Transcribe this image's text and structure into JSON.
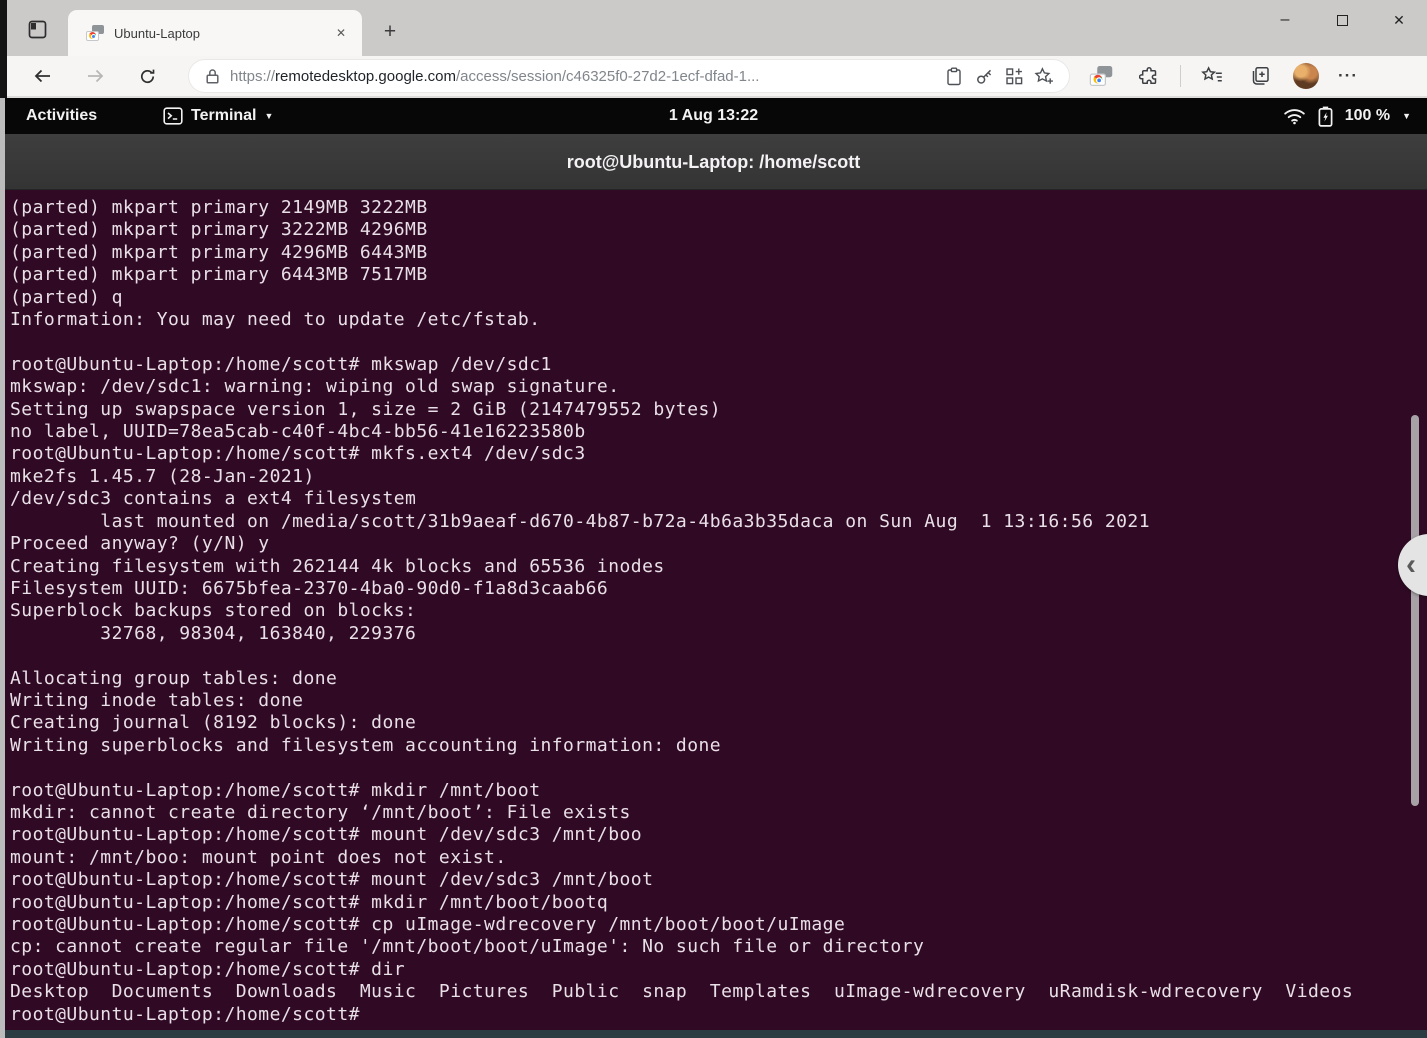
{
  "browser": {
    "tab_title": "Ubuntu-Laptop",
    "url": {
      "scheme": "https://",
      "host": "remotedesktop.google.com",
      "path": "/access/session/c46325f0-27d2-1ecf-dfad-1..."
    }
  },
  "desktop_bar": {
    "activities_label": "Activities",
    "app_name": "Terminal",
    "clock": "1 Aug 13:22",
    "battery_percent": "100 %"
  },
  "terminal": {
    "title": "root@Ubuntu-Laptop: /home/scott",
    "lines": [
      "(parted) mkpart primary 2149MB 3222MB",
      "(parted) mkpart primary 3222MB 4296MB",
      "(parted) mkpart primary 4296MB 6443MB",
      "(parted) mkpart primary 6443MB 7517MB",
      "(parted) q",
      "Information: You may need to update /etc/fstab.",
      "",
      "root@Ubuntu-Laptop:/home/scott# mkswap /dev/sdc1",
      "mkswap: /dev/sdc1: warning: wiping old swap signature.",
      "Setting up swapspace version 1, size = 2 GiB (2147479552 bytes)",
      "no label, UUID=78ea5cab-c40f-4bc4-bb56-41e16223580b",
      "root@Ubuntu-Laptop:/home/scott# mkfs.ext4 /dev/sdc3",
      "mke2fs 1.45.7 (28-Jan-2021)",
      "/dev/sdc3 contains a ext4 filesystem",
      "        last mounted on /media/scott/31b9aeaf-d670-4b87-b72a-4b6a3b35daca on Sun Aug  1 13:16:56 2021",
      "Proceed anyway? (y/N) y",
      "Creating filesystem with 262144 4k blocks and 65536 inodes",
      "Filesystem UUID: 6675bfea-2370-4ba0-90d0-f1a8d3caab66",
      "Superblock backups stored on blocks:",
      "        32768, 98304, 163840, 229376",
      "",
      "Allocating group tables: done",
      "Writing inode tables: done",
      "Creating journal (8192 blocks): done",
      "Writing superblocks and filesystem accounting information: done",
      "",
      "root@Ubuntu-Laptop:/home/scott# mkdir /mnt/boot",
      "mkdir: cannot create directory ‘/mnt/boot’: File exists",
      "root@Ubuntu-Laptop:/home/scott# mount /dev/sdc3 /mnt/boo",
      "mount: /mnt/boo: mount point does not exist.",
      "root@Ubuntu-Laptop:/home/scott# mount /dev/sdc3 /mnt/boot",
      "root@Ubuntu-Laptop:/home/scott# mkdir /mnt/boot/bootq",
      "root@Ubuntu-Laptop:/home/scott# cp uImage-wdrecovery /mnt/boot/boot/uImage",
      "cp: cannot create regular file '/mnt/boot/boot/uImage': No such file or directory",
      "root@Ubuntu-Laptop:/home/scott# dir",
      "Desktop  Documents  Downloads  Music  Pictures  Public  snap  Templates  uImage-wdrecovery  uRamdisk-wdrecovery  Videos",
      "root@Ubuntu-Laptop:/home/scott#"
    ]
  },
  "glyphs": {
    "plus": "+",
    "minimize": "–",
    "close_x": "✕",
    "tab_close_x": "✕",
    "ellipsis": "···",
    "hamburger": "≡",
    "caret_down": "▼",
    "chevron_left": "‹"
  },
  "colors": {
    "terminal_bg": "#300a24",
    "terminal_fg": "#e9dfe7",
    "terminal_close_button": "#e9541d",
    "gnome_bar_bg": "#070707",
    "titlebar_bg": "#cbcac9",
    "bottom_strip": "#2b3c43"
  }
}
